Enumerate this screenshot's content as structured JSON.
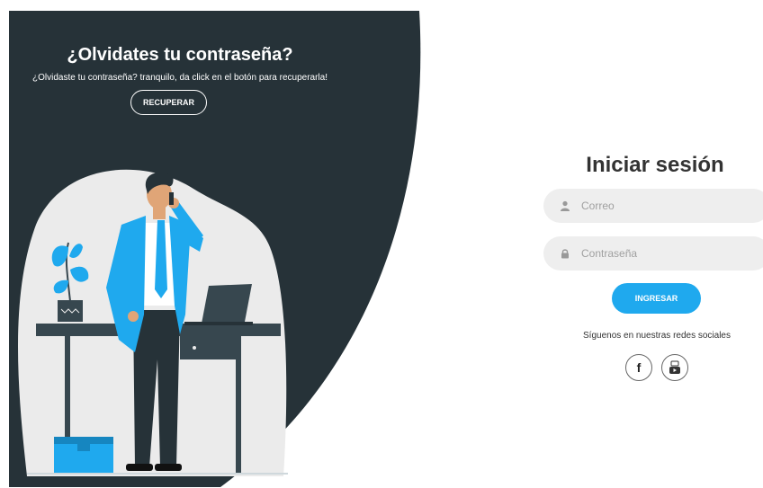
{
  "left_panel": {
    "title": "¿Olvidates tu contraseña?",
    "subtitle": "¿Olvidaste tu contraseña? tranquilo, da click en el botón para recuperarla!",
    "recover_button_label": "RECUPERAR"
  },
  "login": {
    "title": "Iniciar sesión",
    "email_placeholder": "Correo",
    "password_placeholder": "Contraseña",
    "submit_label": "INGRESAR",
    "social_text": "Síguenos en nuestras redes sociales",
    "social_networks": [
      {
        "name": "facebook",
        "icon": "facebook-icon",
        "glyph": "f"
      },
      {
        "name": "youtube",
        "icon": "youtube-icon"
      }
    ]
  },
  "colors": {
    "panel_dark": "#263238",
    "accent_blue": "#1fa9ee",
    "input_bg": "#eeeeee",
    "blob_gray": "#ebebeb"
  }
}
